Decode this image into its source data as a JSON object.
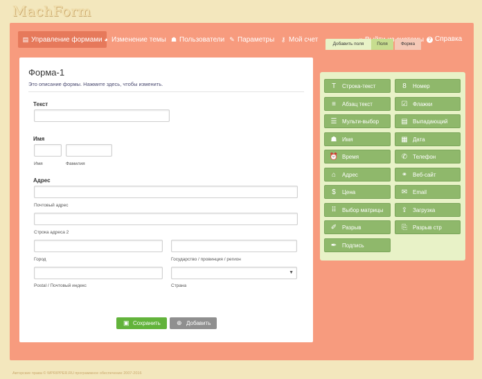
{
  "app": {
    "logo": "MachForm"
  },
  "nav": {
    "items": [
      {
        "label": "Управление формами",
        "icon": "forms-icon",
        "glyph": "▤",
        "active": true
      },
      {
        "label": "Изменение темы",
        "icon": "palette-icon",
        "glyph": "◕"
      },
      {
        "label": "Пользователи",
        "icon": "user-icon",
        "glyph": "☗"
      },
      {
        "label": "Параметры",
        "icon": "wrench-icon",
        "glyph": "✎"
      },
      {
        "label": "Мой счет",
        "icon": "key-icon",
        "glyph": "⚷"
      }
    ],
    "logout": {
      "label": "Выйти из системы",
      "glyph": "⇥"
    },
    "help": {
      "label": "Справка",
      "glyph": "?"
    }
  },
  "form": {
    "title": "Форма-1",
    "description": "Это описание формы. Нажмите здесь, чтобы изменить.",
    "fields": {
      "text_label": "Текст",
      "name_label": "Имя",
      "name_first": "Имя",
      "name_last": "Фамилия",
      "address_label": "Адрес",
      "addr_street": "Почтовый адрес",
      "addr_line2": "Строка адреса 2",
      "addr_city": "Город",
      "addr_state": "Государство / провинция / регион",
      "addr_zip": "Postal / Почтовый индекс",
      "addr_country": "Страна"
    },
    "save_label": "Сохранить",
    "add_label": "Добавить"
  },
  "tabs": [
    {
      "label": "Добавить поля",
      "active": true
    },
    {
      "label": "Поля"
    },
    {
      "label": "Форма"
    }
  ],
  "field_buttons": [
    {
      "label": "Строка-текст",
      "icon": "text-icon",
      "glyph": "T"
    },
    {
      "label": "Номер",
      "icon": "number-icon",
      "glyph": "8"
    },
    {
      "label": "Абзац текст",
      "icon": "paragraph-icon",
      "glyph": "≡"
    },
    {
      "label": "Флажки",
      "icon": "checkbox-icon",
      "glyph": "☑"
    },
    {
      "label": "Мульти-выбор",
      "icon": "list-icon",
      "glyph": "☰"
    },
    {
      "label": "Выпадающий",
      "icon": "dropdown-icon",
      "glyph": "▤"
    },
    {
      "label": "Имя",
      "icon": "user-icon",
      "glyph": "☗"
    },
    {
      "label": "Дата",
      "icon": "calendar-icon",
      "glyph": "▦"
    },
    {
      "label": "Время",
      "icon": "clock-icon",
      "glyph": "⏰"
    },
    {
      "label": "Телефон",
      "icon": "phone-icon",
      "glyph": "✆"
    },
    {
      "label": "Адрес",
      "icon": "home-icon",
      "glyph": "⌂"
    },
    {
      "label": "Веб-сайт",
      "icon": "link-icon",
      "glyph": "⚭"
    },
    {
      "label": "Цена",
      "icon": "price-icon",
      "glyph": "$"
    },
    {
      "label": "Email",
      "icon": "email-icon",
      "glyph": "✉"
    },
    {
      "label": "Выбор матрицы",
      "icon": "matrix-icon",
      "glyph": "⠿"
    },
    {
      "label": "Загрузка",
      "icon": "upload-icon",
      "glyph": "⇪"
    },
    {
      "label": "Разрыв",
      "icon": "break-icon",
      "glyph": "✐"
    },
    {
      "label": "Разрыв стр",
      "icon": "pagebreak-icon",
      "glyph": "⎘"
    },
    {
      "label": "Подпись",
      "icon": "signature-icon",
      "glyph": "✒"
    }
  ],
  "footer": "Авторские права © WPRIPPER.RU программное обеспечение 2007-2016"
}
